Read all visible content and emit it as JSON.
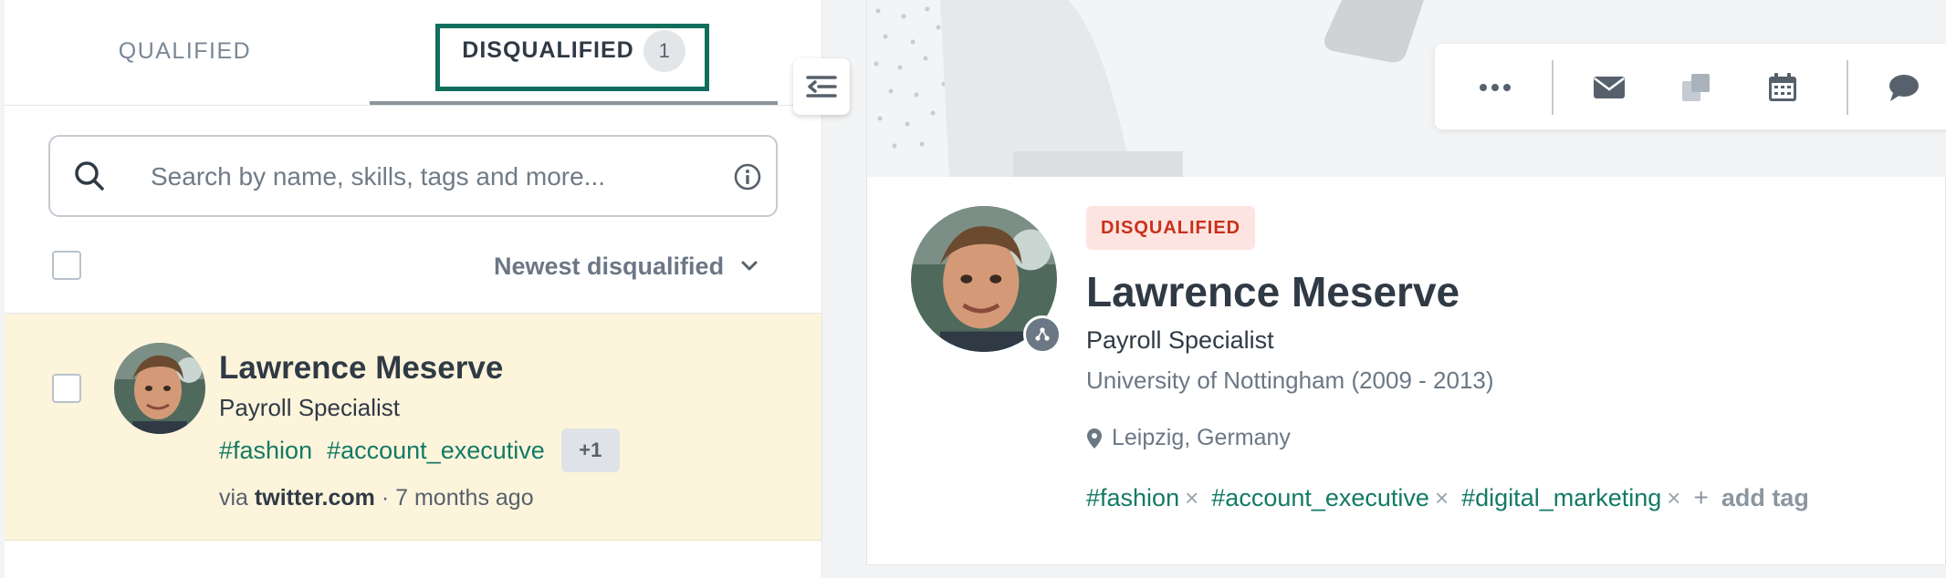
{
  "tabs": {
    "qualified_label": "QUALIFIED",
    "disqualified_label": "DISQUALIFIED",
    "disqualified_count": "1"
  },
  "search": {
    "placeholder": "Search by name, skills, tags and more..."
  },
  "sort": {
    "label": "Newest disqualified"
  },
  "candidate_list": [
    {
      "name": "Lawrence Meserve",
      "role": "Payroll Specialist",
      "tags": [
        "#fashion",
        "#account_executive"
      ],
      "more_tags": "+1",
      "source_prefix": "via",
      "source": "twitter.com",
      "age": "· 7 months ago"
    }
  ],
  "toolbar": {
    "icons": [
      "more-icon",
      "email-icon",
      "copy-icon",
      "calendar-icon",
      "comment-icon"
    ]
  },
  "profile": {
    "status": "DISQUALIFIED",
    "name": "Lawrence Meserve",
    "role": "Payroll Specialist",
    "education": "University of Nottingham (2009 - 2013)",
    "location": "Leipzig, Germany",
    "tags": [
      "#fashion",
      "#account_executive",
      "#digital_marketing"
    ],
    "remove_tag_glyph": "×",
    "add_tag_plus": "+",
    "add_tag_label": "add tag"
  },
  "colors": {
    "accent_green": "#137a64",
    "focus_ring": "#116d5c",
    "selected_row_bg": "#fdf4dc",
    "disqualified_badge_bg": "#fde4e0",
    "disqualified_badge_text": "#c9301b"
  }
}
